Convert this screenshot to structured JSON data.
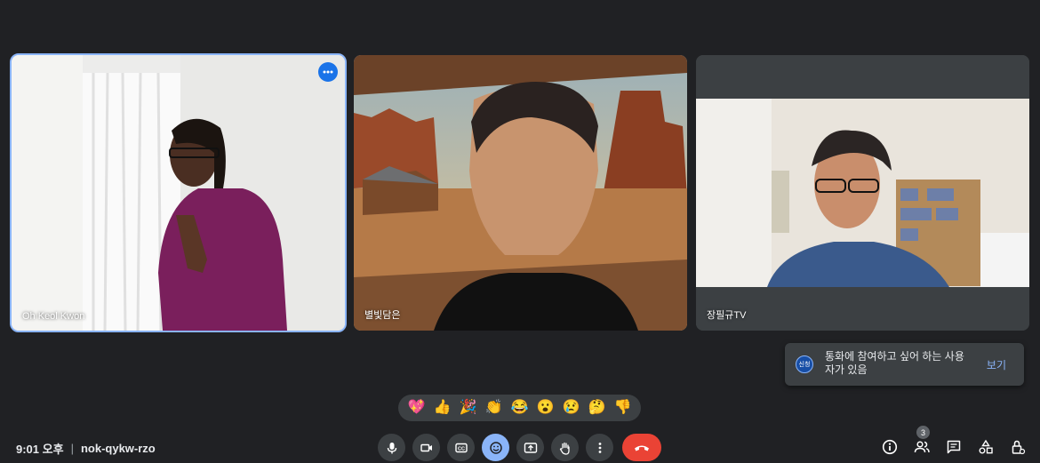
{
  "participants": [
    {
      "name": "Oh Keol Kwon",
      "active": true
    },
    {
      "name": "별빛담은"
    },
    {
      "name": "장필규TV"
    }
  ],
  "toast": {
    "badge": "신청",
    "message": "통화에 참여하고 싶어 하는 사용자가 있음",
    "action": "보기"
  },
  "reactions": [
    "💖",
    "👍",
    "🎉",
    "👏",
    "😂",
    "😮",
    "😢",
    "🤔",
    "👎"
  ],
  "meeting": {
    "time": "9:01 오후",
    "separator": "|",
    "code": "nok-qykw-rzo"
  },
  "people_count": "3",
  "colors": {
    "accent": "#8ab4f8",
    "end_call": "#ea4335",
    "background": "#202124"
  },
  "icons": {
    "controls": [
      "mic-icon",
      "camera-icon",
      "captions-icon",
      "emoji-icon",
      "present-icon",
      "raise-hand-icon",
      "more-options-icon",
      "end-call-icon"
    ],
    "right": [
      "info-icon",
      "people-icon",
      "chat-icon",
      "activities-icon",
      "host-controls-icon"
    ]
  }
}
